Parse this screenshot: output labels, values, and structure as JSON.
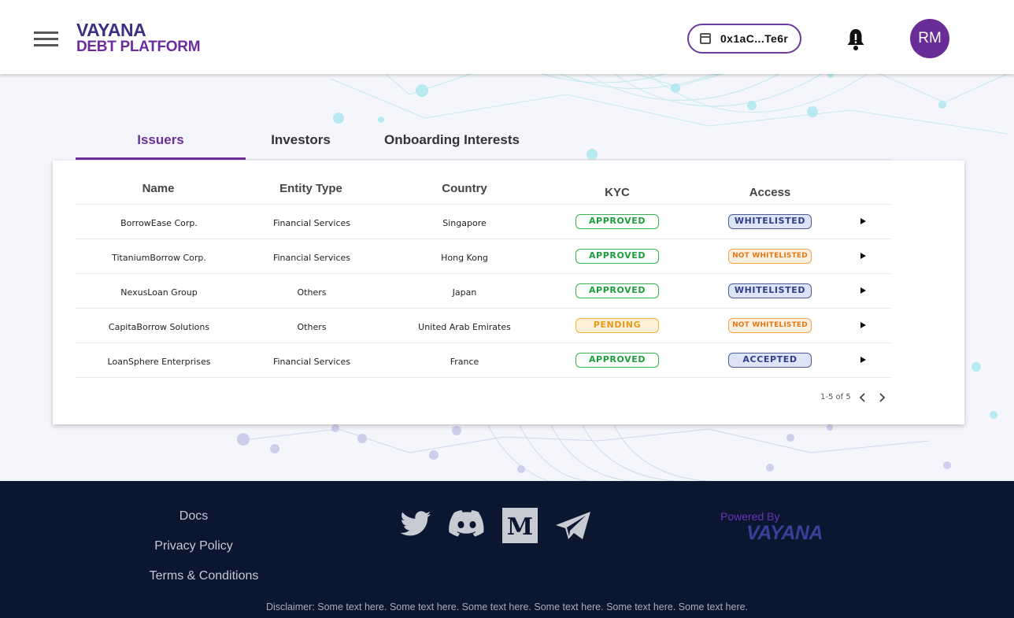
{
  "header": {
    "logo_line1": "VAYANA",
    "logo_line2": "DEBT PLATFORM",
    "wallet_address": "0x1aC...Te6r",
    "avatar_initials": "RM"
  },
  "tabs": [
    {
      "label": "Issuers",
      "active": true
    },
    {
      "label": "Investors",
      "active": false
    },
    {
      "label": "Onboarding Interests",
      "active": false
    }
  ],
  "table": {
    "columns": [
      "Name",
      "Entity Type",
      "Country",
      "KYC",
      "Access"
    ],
    "rows": [
      {
        "name": "BorrowEase Corp.",
        "entity_type": "Financial Services",
        "country": "Singapore",
        "kyc": "APPROVED",
        "access": "WHITELISTED"
      },
      {
        "name": "TitaniumBorrow Corp.",
        "entity_type": "Financial Services",
        "country": "Hong Kong",
        "kyc": "APPROVED",
        "access": "NOT WHITELISTED"
      },
      {
        "name": "NexusLoan Group",
        "entity_type": "Others",
        "country": "Japan",
        "kyc": "APPROVED",
        "access": "WHITELISTED"
      },
      {
        "name": "CapitaBorrow Solutions",
        "entity_type": "Others",
        "country": "United Arab Emirates",
        "kyc": "PENDING",
        "access": "NOT WHITELISTED"
      },
      {
        "name": "LoanSphere Enterprises",
        "entity_type": "Financial Services",
        "country": "France",
        "kyc": "APPROVED",
        "access": "ACCEPTED"
      }
    ],
    "pagination": "1-5 of 5"
  },
  "footer": {
    "links": [
      "Docs",
      "Privacy Policy",
      "Terms & Conditions"
    ],
    "social_icons": [
      "twitter-icon",
      "discord-icon",
      "medium-icon",
      "telegram-icon"
    ],
    "powered_by": "Powered By",
    "powered_logo": "VAYANA",
    "disclaimer": "Disclaimer: Some text here. Some text here. Some text here. Some text here. Some text here. Some text here."
  },
  "colors": {
    "brand_purple": "#6b2f9a",
    "brand_navy": "#3e2f83",
    "footer_bg": "#0b1630",
    "approved_green": "#1a9f3b",
    "pending_orange": "#e69a1a"
  }
}
